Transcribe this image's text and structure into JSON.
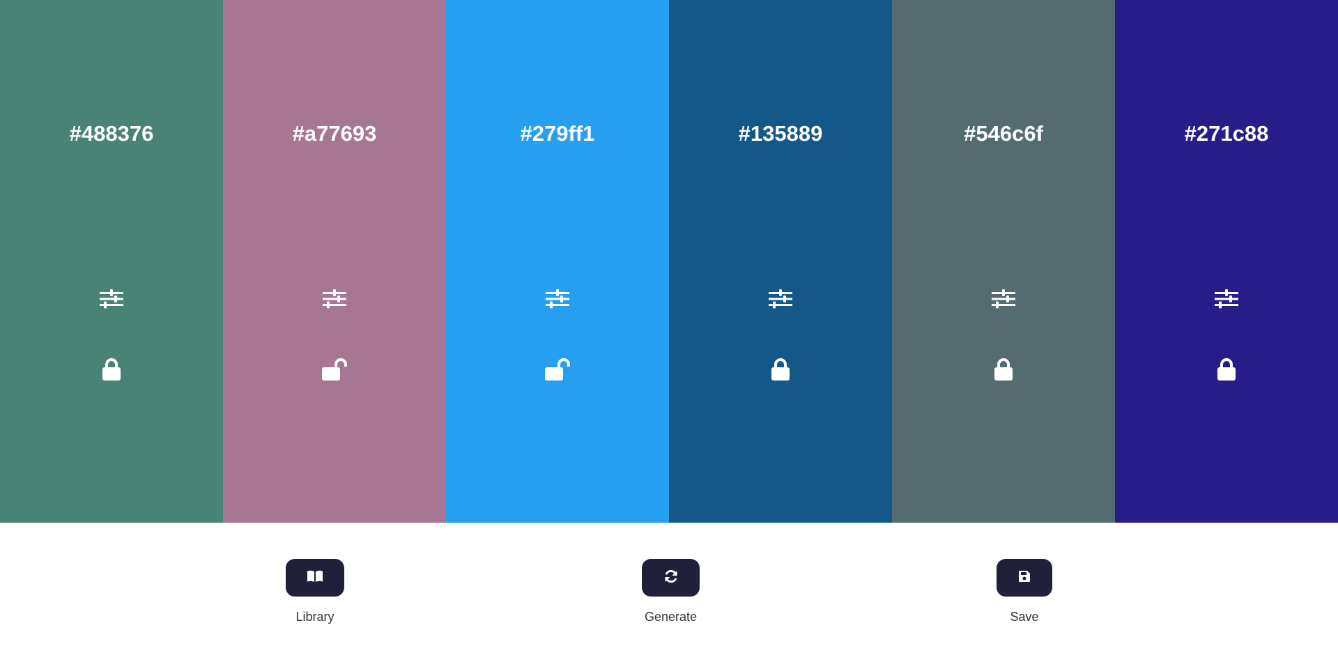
{
  "palette": {
    "swatches": [
      {
        "hex": "#488376",
        "color": "#488376",
        "locked": true,
        "lock_icon": "lock-icon",
        "adjust_icon": "sliders-icon"
      },
      {
        "hex": "#a77693",
        "color": "#a77693",
        "locked": false,
        "lock_icon": "unlock-icon",
        "adjust_icon": "sliders-icon"
      },
      {
        "hex": "#279ff1",
        "color": "#279ff1",
        "locked": false,
        "lock_icon": "unlock-icon",
        "adjust_icon": "sliders-icon"
      },
      {
        "hex": "#135889",
        "color": "#135889",
        "locked": true,
        "lock_icon": "lock-icon",
        "adjust_icon": "sliders-icon"
      },
      {
        "hex": "#546c6f",
        "color": "#546c6f",
        "locked": true,
        "lock_icon": "lock-icon",
        "adjust_icon": "sliders-icon"
      },
      {
        "hex": "#271c88",
        "color": "#271c88",
        "locked": true,
        "lock_icon": "lock-icon",
        "adjust_icon": "sliders-icon"
      }
    ]
  },
  "actions": {
    "button_color": "#20203b",
    "library": {
      "label": "Library",
      "icon": "book-open-icon"
    },
    "generate": {
      "label": "Generate",
      "icon": "refresh-icon"
    },
    "save": {
      "label": "Save",
      "icon": "floppy-disk-icon"
    }
  }
}
